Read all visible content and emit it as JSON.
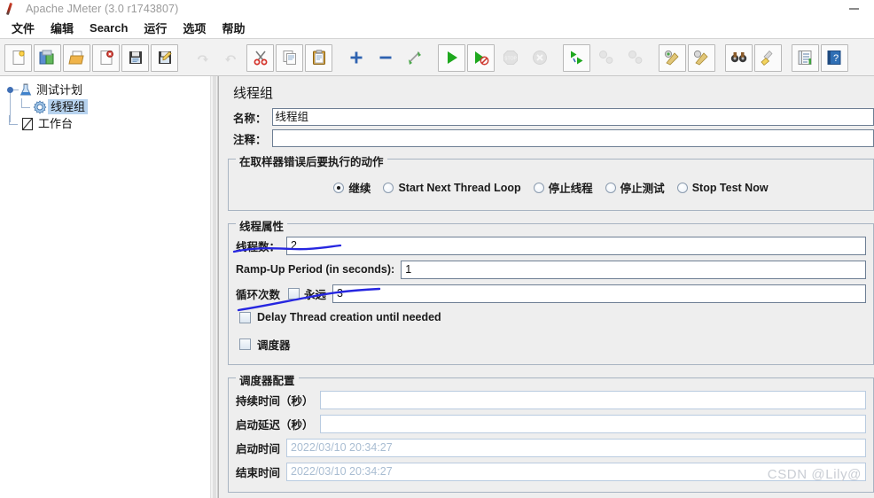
{
  "window": {
    "title": "Apache JMeter (3.0 r1743807)",
    "app_icon": "jmeter-feather-icon",
    "minimize_label": "—"
  },
  "menubar": {
    "items": [
      {
        "label": "文件",
        "name": "menu-file"
      },
      {
        "label": "编辑",
        "name": "menu-edit"
      },
      {
        "label": "Search",
        "name": "menu-search"
      },
      {
        "label": "运行",
        "name": "menu-run"
      },
      {
        "label": "选项",
        "name": "menu-options"
      },
      {
        "label": "帮助",
        "name": "menu-help"
      }
    ]
  },
  "toolbar": {
    "buttons": [
      {
        "icon": "new-document-icon",
        "enabled": true
      },
      {
        "icon": "templates-icon",
        "enabled": true
      },
      {
        "icon": "open-folder-icon",
        "enabled": true
      },
      {
        "icon": "close-document-icon",
        "enabled": true
      },
      {
        "icon": "save-icon",
        "enabled": true
      },
      {
        "icon": "save-as-icon",
        "enabled": true
      },
      {
        "icon": "undo-icon",
        "enabled": false
      },
      {
        "icon": "redo-icon",
        "enabled": false
      },
      {
        "icon": "cut-scissors-icon",
        "enabled": true
      },
      {
        "icon": "copy-icon",
        "enabled": true
      },
      {
        "icon": "paste-clipboard-icon",
        "enabled": true
      },
      {
        "icon": "expand-all-plus-icon",
        "enabled": true
      },
      {
        "icon": "collapse-all-minus-icon",
        "enabled": true
      },
      {
        "icon": "toggle-enable-icon",
        "enabled": true
      },
      {
        "icon": "start-play-icon",
        "enabled": true
      },
      {
        "icon": "start-no-timers-icon",
        "enabled": true
      },
      {
        "icon": "stop-icon",
        "enabled": false
      },
      {
        "icon": "shutdown-icon",
        "enabled": false
      },
      {
        "icon": "remote-start-all-icon",
        "enabled": true
      },
      {
        "icon": "remote-stop-all-icon",
        "enabled": false
      },
      {
        "icon": "remote-shutdown-all-icon",
        "enabled": false
      },
      {
        "icon": "clear-icon",
        "enabled": true
      },
      {
        "icon": "clear-all-icon",
        "enabled": true
      },
      {
        "icon": "search-binoculars-icon",
        "enabled": true
      },
      {
        "icon": "reset-search-broom-icon",
        "enabled": true
      },
      {
        "icon": "function-helper-icon",
        "enabled": true
      },
      {
        "icon": "help-icon",
        "enabled": true
      }
    ]
  },
  "tree": {
    "nodes": [
      {
        "label": "测试计划",
        "icon": "test-plan-icon",
        "selected": false,
        "level": 0
      },
      {
        "label": "线程组",
        "icon": "thread-group-gear-icon",
        "selected": true,
        "level": 1
      },
      {
        "label": "工作台",
        "icon": "workbench-icon",
        "selected": false,
        "level": 0
      }
    ]
  },
  "panel": {
    "title": "线程组",
    "name_label": "名称：",
    "name_value": "线程组",
    "comment_label": "注释：",
    "comment_value": "",
    "on_error": {
      "title": "在取样器错误后要执行的动作",
      "options": [
        {
          "label": "继续",
          "selected": true
        },
        {
          "label": "Start Next Thread Loop",
          "selected": false
        },
        {
          "label": "停止线程",
          "selected": false
        },
        {
          "label": "停止测试",
          "selected": false
        },
        {
          "label": "Stop Test Now",
          "selected": false
        }
      ]
    },
    "thread_properties": {
      "title": "线程属性",
      "num_threads_label": "线程数：",
      "num_threads_value": "2",
      "ramp_up_label": "Ramp-Up Period (in seconds):",
      "ramp_up_value": "1",
      "loop_count_label": "循环次数",
      "forever_label": "永远",
      "forever_checked": false,
      "loop_count_value": "3",
      "delay_thread_label": "Delay Thread creation until needed",
      "delay_thread_checked": false,
      "scheduler_label": "调度器",
      "scheduler_checked": false
    },
    "scheduler_config": {
      "title": "调度器配置",
      "rows": [
        {
          "label": "持续时间（秒）",
          "value": "",
          "placeholder": false
        },
        {
          "label": "启动延迟（秒）",
          "value": "",
          "placeholder": false
        },
        {
          "label": "启动时间",
          "value": "2022/03/10 20:34:27",
          "placeholder": true
        },
        {
          "label": "结束时间",
          "value": "2022/03/10 20:34:27",
          "placeholder": true
        }
      ]
    }
  },
  "watermark": {
    "text": "CSDN @Lily@"
  },
  "colors": {
    "selection": "#b6d2ee",
    "annotation": "#2222dd",
    "panel_bg": "#eeeeee",
    "field_border": "#6e7f94",
    "placeholder_text": "#a9bdd2"
  }
}
